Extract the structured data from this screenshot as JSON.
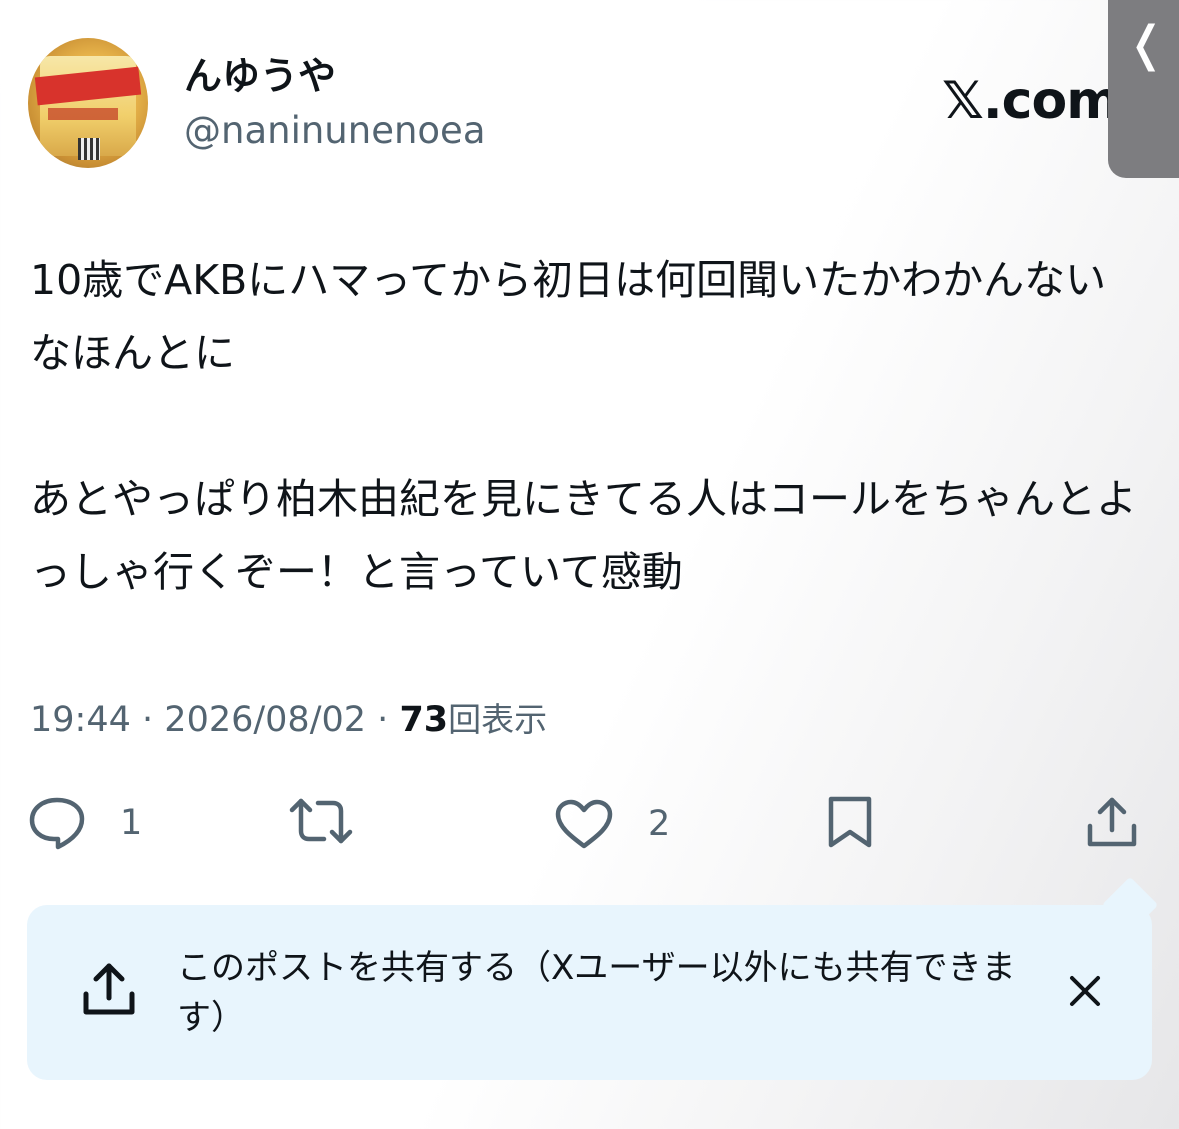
{
  "author": {
    "display_name": "んゆうや",
    "handle": "@naninunenoea",
    "avatar_icon": "snack-cup-avatar"
  },
  "brand": {
    "logo_text": "𝕏.com"
  },
  "edge_tab": {
    "icon": "chevron-left-icon",
    "glyph": "❬"
  },
  "tweet": {
    "paragraph1": "10歳でAKBにハマってから初日は何回聞いたかわかんないなほんとに",
    "paragraph2": "あとやっぱり柏木由紀を見にきてる人はコールをちゃんとよっしゃ行くぞー！と言っていて感動"
  },
  "meta": {
    "time": "19:44",
    "separator": "·",
    "date": "2026/08/02",
    "views_count": "73",
    "views_label": "回表示"
  },
  "actions": {
    "reply": {
      "icon": "reply-icon",
      "count": "1"
    },
    "retweet": {
      "icon": "retweet-icon"
    },
    "like": {
      "icon": "heart-icon",
      "count": "2"
    },
    "bookmark": {
      "icon": "bookmark-icon"
    },
    "share": {
      "icon": "share-icon"
    }
  },
  "share_popup": {
    "message": "このポストを共有する（Xユーザー以外にも共有できます）",
    "icon": "share-upload-icon",
    "close_icon": "close-icon",
    "close_glyph": "✕"
  },
  "colors": {
    "text": "#0f1419",
    "secondary": "#536471",
    "popup_bg": "#e8f5fd"
  }
}
